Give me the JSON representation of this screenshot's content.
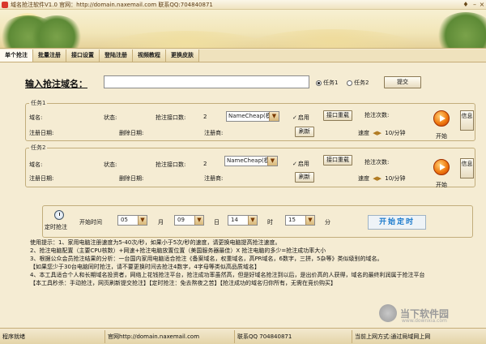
{
  "window": {
    "title": "域名抢注软件V1.0 官网：http://domain.naxemail.com 联系QQ:704840871"
  },
  "tabs": [
    "单个抢注",
    "批量注册",
    "接口设置",
    "登陆注册",
    "视频教程",
    "更换皮肤"
  ],
  "domain": {
    "label": "输入抢注域名：",
    "value": "",
    "radio1": "任务1",
    "radio2": "任务2",
    "submit": "提交"
  },
  "task1": {
    "legend": "任务1",
    "domain_label": "域名:",
    "status_label": "状态:",
    "iface_count_label": "抢注接口数:",
    "iface_count": "2",
    "provider": "NameCheap(模)",
    "enable_label": "启用",
    "reset_label": "接口重载",
    "attempts_label": "抢注次数:",
    "reg_date_label": "注册日期:",
    "del_date_label": "删除日期:",
    "registrar_label": "注册商:",
    "refresh_label": "刷新",
    "speed_label": "速度",
    "speed_value": "10/分钟",
    "start_label": "开始",
    "info_label": "信息"
  },
  "task2": {
    "legend": "任务2",
    "domain_label": "域名:",
    "status_label": "状态:",
    "iface_count_label": "抢注接口数:",
    "iface_count": "2",
    "provider": "NameCheap(模)",
    "enable_label": "启用",
    "reset_label": "接口重载",
    "attempts_label": "抢注次数:",
    "reg_date_label": "注册日期:",
    "del_date_label": "删除日期:",
    "registrar_label": "注册商:",
    "refresh_label": "刷新",
    "speed_label": "速度",
    "speed_value": "10/分钟",
    "start_label": "开始",
    "info_label": "信息"
  },
  "timer": {
    "label": "定时抢注",
    "start_time_label": "开始时间",
    "month": "05",
    "month_label": "月",
    "day": "09",
    "day_label": "日",
    "hour": "14",
    "hour_label": "时",
    "minute": "15",
    "minute_label": "分",
    "button": "开始定时"
  },
  "tips": [
    "使用提示：1、家用电脑注册速度为5-40次/秒，如果小于5次/秒的速度，请更换电脑提高抢注速度。",
    "2、抢注电脑配置（主要CPU核数）+网速+抢注电脑放置位置（美国服务器最佳）X 抢注电脑的多少=抢注成功率大小",
    "3、根据公众会员抢注结果的分析：一台国内家用电脑适合抢注《备案域名，权重域名，高PR域名，6数字，三拼，5杂等》类似级别的域名。",
    "【如果您少于30台电脑同时抢注，请不要更换时间去抢注4数字，4字母等类似高品质域名】",
    "4、本工具适合个人和长期域名投资者，网络上花钱抢注平台，抢注成功率虽然高，但是好域名抢注到以后，是出价高的人获得，域名的最终利润属于抢注平台",
    "【本工具秒杀：手动抢注，网页刷新提交抢注】【定时抢注：免去熬夜之苦】【抢注成功的域名归你所有，无需在竞价购买】"
  ],
  "watermark": {
    "text": "当下软件园",
    "sub": "www.downxia.com"
  },
  "status": {
    "ready": "程序就绪",
    "site": "官网http://domain.naxemail.com",
    "qq": "联系QQ 704840871",
    "network": "当前上网方式:通过局域网上网"
  }
}
